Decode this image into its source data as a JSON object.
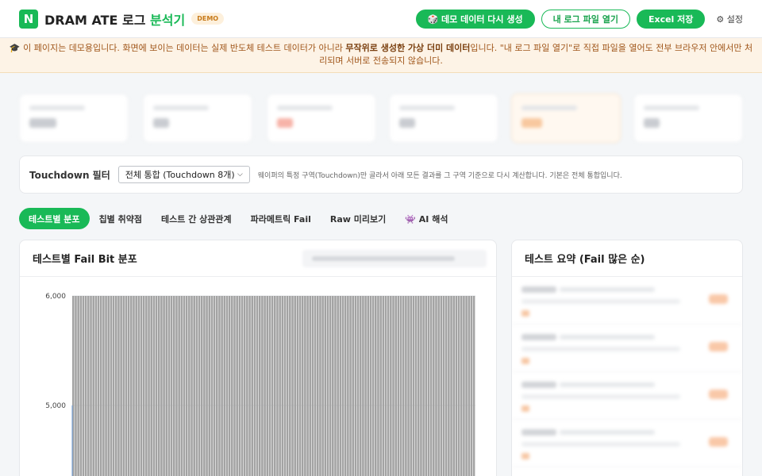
{
  "header": {
    "logo_letter": "N",
    "title_main": "DRAM ATE 로그 ",
    "title_accent": "분석기",
    "demo_badge": "DEMO",
    "actions": {
      "regen_label": "🎲 데모 데이터 다시 생성",
      "open_label": "내 로그 파일 열기",
      "excel_label": "Excel 저장",
      "settings_label": "⚙ 설정"
    }
  },
  "notice": {
    "part1": "🎓 이 페이지는 데모용입니다. 화면에 보이는 데이터는 실제 반도체 테스트 데이터가 아니라 ",
    "bold": "무작위로 생성한 가상 더미 데이터",
    "part2": "입니다. \"내 로그 파일 열기\"로 직접 파일을 열어도 전부 브라우저 안에서만 처리되며 서버로 전송되지 않습니다."
  },
  "filter": {
    "label": "Touchdown 필터",
    "selected": "전체 통합 (Touchdown 8개)",
    "description": "웨이퍼의 특정 구역(Touchdown)만 골라서 아래 모든 결과를 그 구역 기준으로 다시 계산합니다. 기본은 전체 통합입니다."
  },
  "tabs": [
    {
      "label": "테스트별 분포",
      "active": true
    },
    {
      "label": "칩별 취약점",
      "active": false
    },
    {
      "label": "테스트 간 상관관계",
      "active": false
    },
    {
      "label": "파라메트릭 Fail",
      "active": false
    },
    {
      "label": "Raw 미리보기",
      "active": false
    },
    {
      "label": "👾 AI 해석",
      "active": false
    }
  ],
  "chart_card": {
    "title": "테스트별 Fail Bit 분포"
  },
  "side_card": {
    "title": "테스트 요약 (Fail 많은 순)"
  },
  "colors": {
    "accent": "#19b957",
    "bar": "#a3a3a3",
    "notice_bg": "#fdf3e6"
  },
  "chart_data": {
    "type": "bar",
    "y_ticks": [
      "6,000",
      "5,000"
    ],
    "ylim_visible": [
      4300,
      6000
    ],
    "bar_count": 160,
    "bar_value_approx": 6000,
    "grid": true
  }
}
